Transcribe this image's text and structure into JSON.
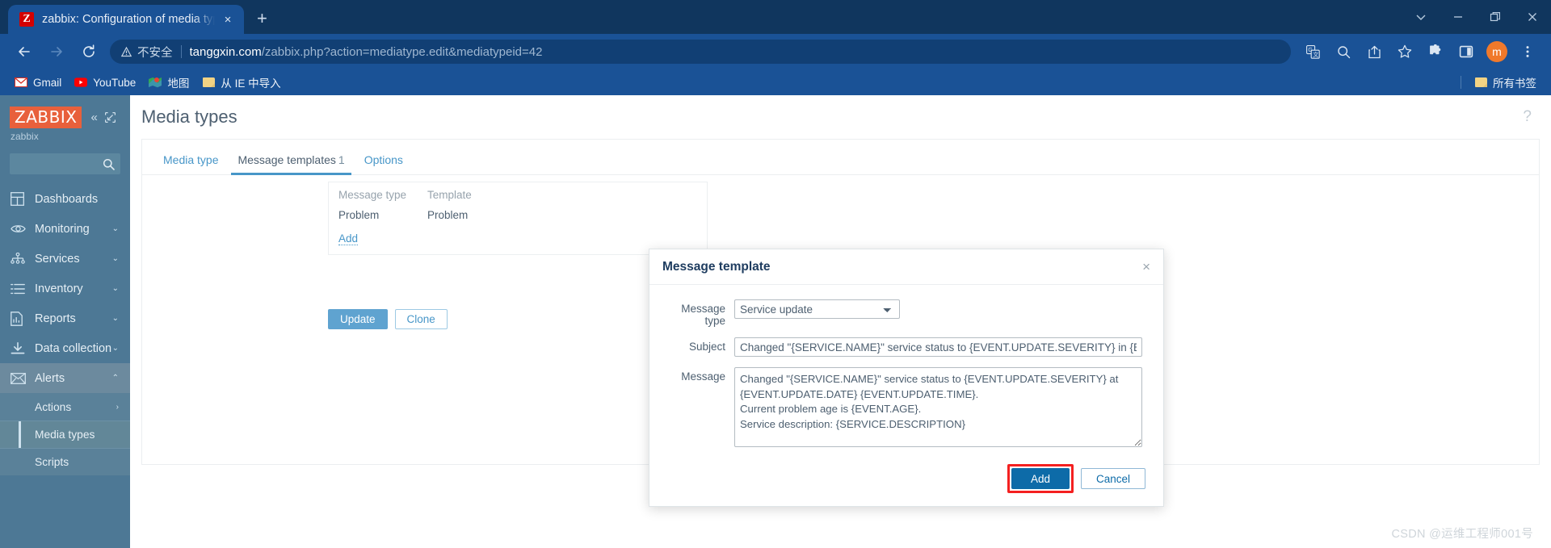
{
  "browser": {
    "tab": {
      "title": "zabbix: Configuration of media types",
      "favicon_letter": "Z",
      "close_label": "×",
      "new_tab_label": "+"
    },
    "window_controls": {
      "tab_search": "tab-search",
      "minimize": "minimize",
      "restore": "restore",
      "close": "close"
    },
    "toolbar": {
      "back": "back",
      "forward": "forward",
      "reload": "reload",
      "insecure_label": "不安全",
      "url_host": "tanggxin.com",
      "url_path": "/zabbix.php?action=mediatype.edit&mediatypeid=42",
      "avatar_letter": "m"
    },
    "bookmarks": [
      {
        "label": "Gmail",
        "icon": "gmail-icon"
      },
      {
        "label": "YouTube",
        "icon": "youtube-icon"
      },
      {
        "label": "地图",
        "icon": "maps-icon"
      },
      {
        "label": "从 IE 中导入",
        "icon": "folder-icon"
      }
    ],
    "all_bookmarks_label": "所有书签"
  },
  "zabbix": {
    "sidebar": {
      "logo": "ZABBIX",
      "server_name": "zabbix",
      "search_placeholder": "",
      "items": [
        {
          "label": "Dashboards",
          "icon": "dashboard-icon",
          "caret": "",
          "active": false
        },
        {
          "label": "Monitoring",
          "icon": "eye-icon",
          "caret": "⌄",
          "active": false
        },
        {
          "label": "Services",
          "icon": "services-icon",
          "caret": "⌄",
          "active": false
        },
        {
          "label": "Inventory",
          "icon": "list-icon",
          "caret": "⌄",
          "active": false
        },
        {
          "label": "Reports",
          "icon": "report-icon",
          "caret": "⌄",
          "active": false
        },
        {
          "label": "Data collection",
          "icon": "download-icon",
          "caret": "⌄",
          "active": false
        },
        {
          "label": "Alerts",
          "icon": "envelope-icon",
          "caret": "⌃",
          "active": true
        }
      ],
      "sub_items": [
        {
          "label": "Actions",
          "caret": "›",
          "selected": false
        },
        {
          "label": "Media types",
          "caret": "",
          "selected": true
        },
        {
          "label": "Scripts",
          "caret": "",
          "selected": false
        }
      ]
    },
    "header": {
      "title": "Media types",
      "help_icon": "?"
    },
    "form": {
      "tabs": [
        {
          "label": "Media type",
          "count": "",
          "active": false
        },
        {
          "label": "Message templates",
          "count": "1",
          "active": true
        },
        {
          "label": "Options",
          "count": "",
          "active": false
        }
      ],
      "templates_table": {
        "columns": [
          "Message type",
          "Template"
        ],
        "rows": [
          [
            "Problem",
            "Problem"
          ]
        ],
        "add_label": "Add"
      },
      "buttons": [
        {
          "label": "Update",
          "style": "primary"
        },
        {
          "label": "Clone",
          "style": "secondary"
        }
      ]
    },
    "modal": {
      "title": "Message template",
      "close_label": "×",
      "fields": {
        "message_type_label": "Message type",
        "message_type_value": "Service update",
        "message_type_options": [
          "Service update"
        ],
        "subject_label": "Subject",
        "subject_value": "Changed \"{SERVICE.NAME}\" service status to {EVENT.UPDATE.SEVERITY} in {EVENT.UPDATE.STATUS}",
        "message_label": "Message",
        "message_value": "Changed \"{SERVICE.NAME}\" service status to {EVENT.UPDATE.SEVERITY} at {EVENT.UPDATE.DATE} {EVENT.UPDATE.TIME}.\nCurrent problem age is {EVENT.AGE}.\nService description: {SERVICE.DESCRIPTION}\n\n{SERVICE.ROOTCAUSE}"
      },
      "add_label": "Add",
      "cancel_label": "Cancel"
    }
  },
  "watermark": "CSDN @运维工程师001号",
  "colors": {
    "chrome_blue": "#1a5296",
    "chrome_dark": "#10365e",
    "zabbix_red": "#e8603c",
    "sidebar": "#4d7895",
    "accent": "#4796c8",
    "add_button": "#0d6ba8",
    "highlight": "#f42020"
  }
}
